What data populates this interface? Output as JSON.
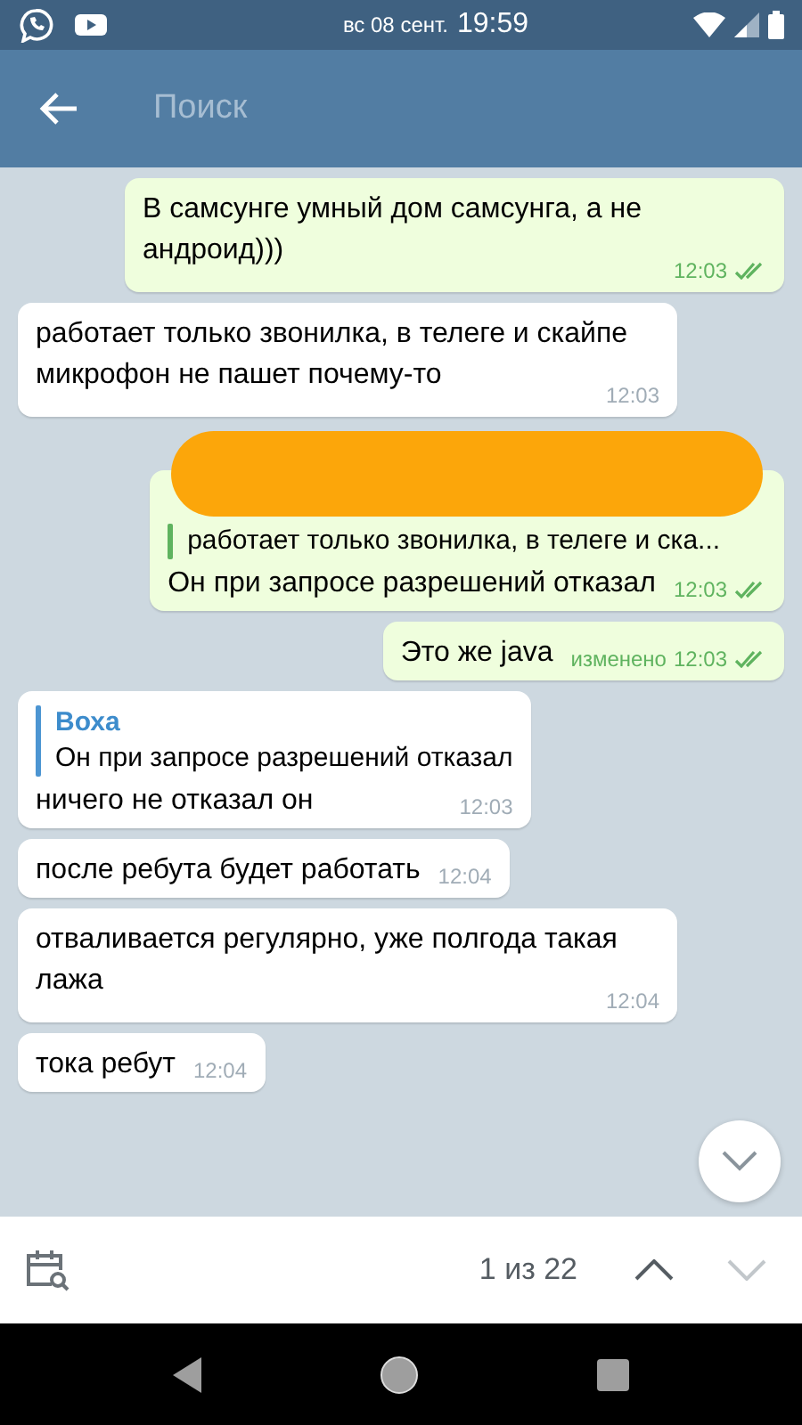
{
  "status_bar": {
    "date": "вс 08 сент.",
    "time": "19:59"
  },
  "header": {
    "search": {
      "placeholder": "Поиск"
    }
  },
  "messages": [
    {
      "kind": "outgoing",
      "text": "В самсунге умный дом самсунга, а не андроид)))",
      "time": "12:03",
      "read": true
    },
    {
      "kind": "incoming",
      "text": "работает только звонилка, в телеге и скайпе микрофон не пашет почему-то",
      "time": "12:03"
    },
    {
      "kind": "outgoing",
      "reply": {
        "redacted": true,
        "text": "работает только звонилка, в телеге и ска..."
      },
      "text": "Он при запросе разрешений отказал",
      "time": "12:03",
      "read": true
    },
    {
      "kind": "outgoing",
      "text": "Это же java",
      "edited": "изменено",
      "time": "12:03",
      "read": true
    },
    {
      "kind": "incoming",
      "reply": {
        "name": "Воха",
        "text": "Он при запросе разрешений отказал"
      },
      "text": "ничего не отказал он",
      "time": "12:03"
    },
    {
      "kind": "incoming",
      "text": "после ребута будет работать",
      "time": "12:04"
    },
    {
      "kind": "incoming",
      "text": "отваливается регулярно, уже полгода такая лажа",
      "time": "12:04"
    },
    {
      "kind": "incoming",
      "text": "тока ребут",
      "time": "12:04"
    }
  ],
  "search_nav": {
    "counter": "1 из 22",
    "up_enabled": true,
    "down_enabled": false
  }
}
